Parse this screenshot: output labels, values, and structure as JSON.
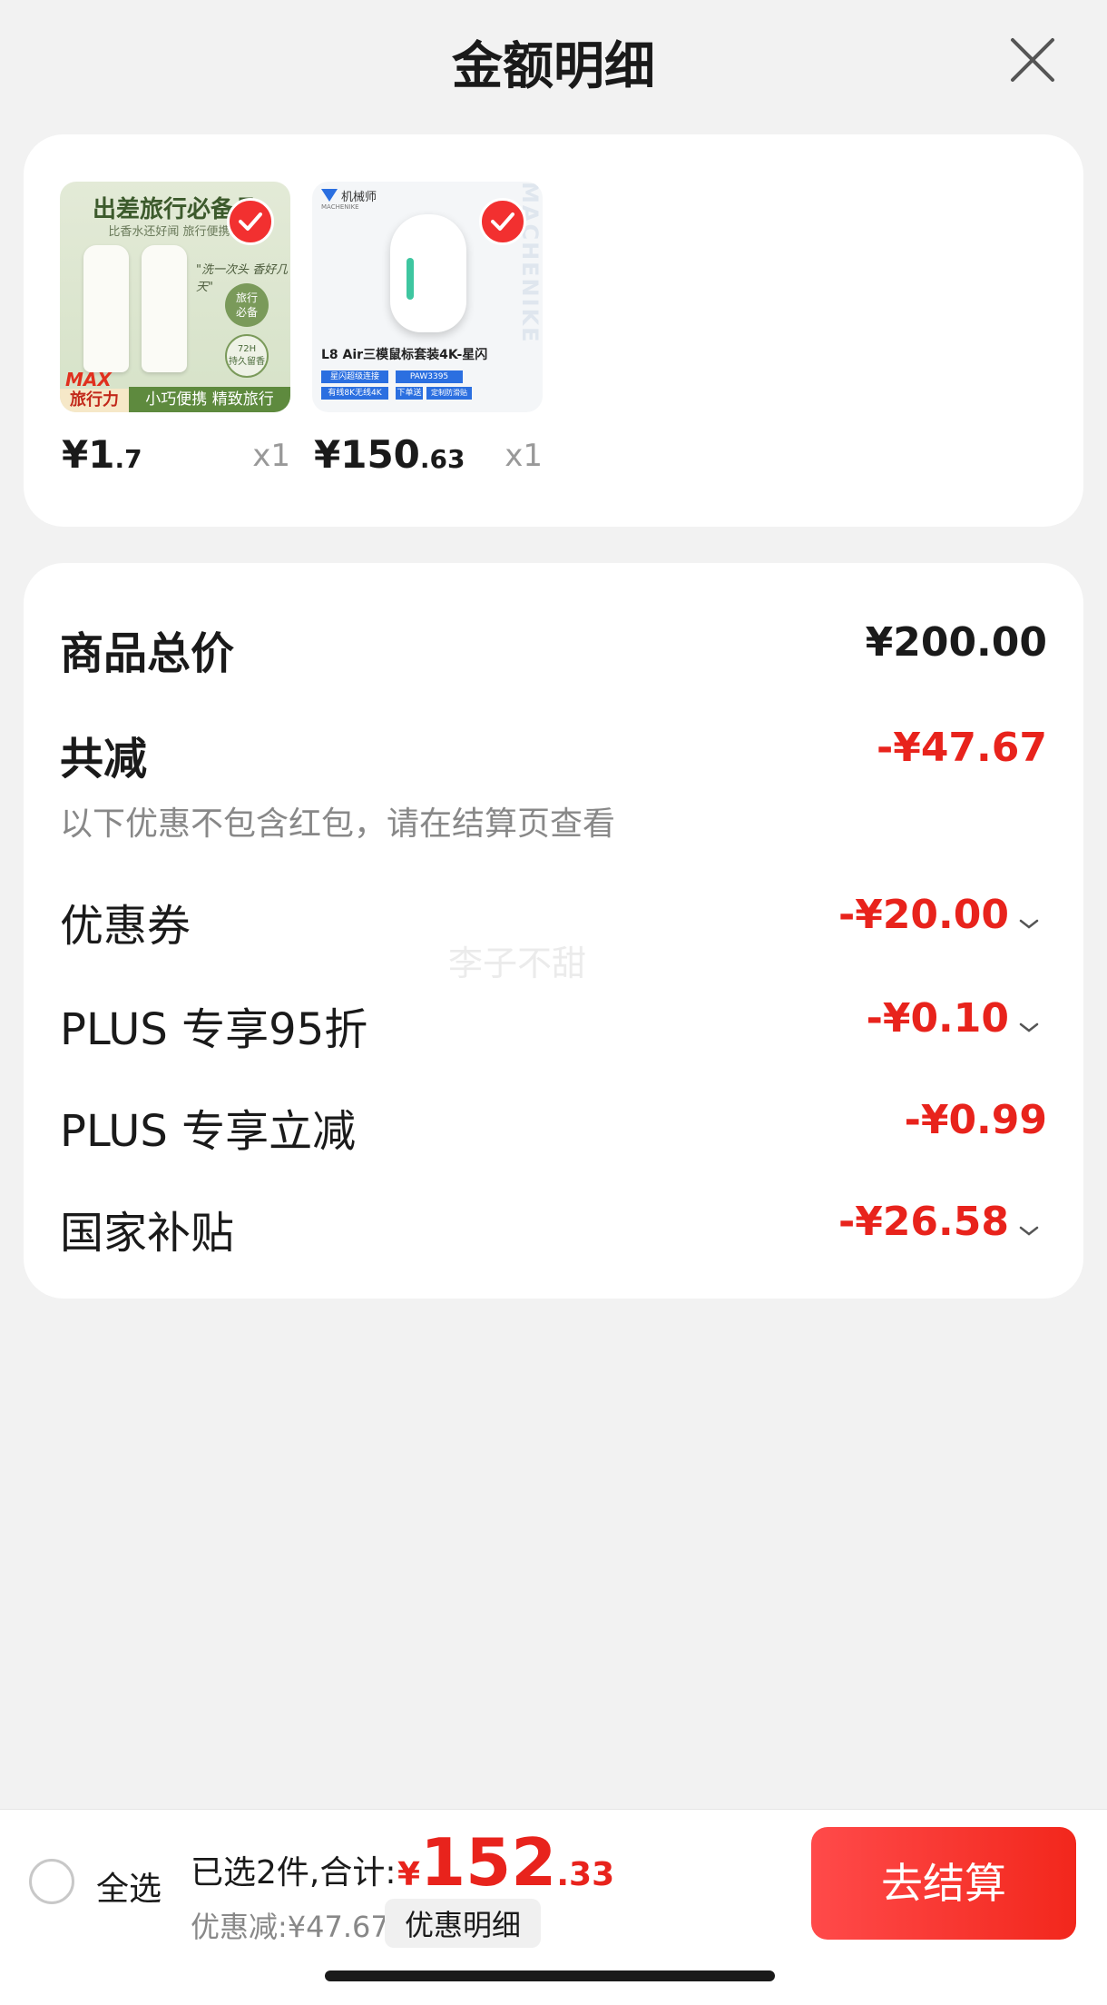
{
  "header": {
    "title": "金额明细"
  },
  "products": [
    {
      "price_int": "¥1",
      "price_dec": ".7",
      "qty": "x1",
      "image_text": {
        "headline": "出差旅行必备品",
        "sub": "比香水还好闻 旅行便携装",
        "quote": "\"洗一次头 香好几天\"",
        "badge1": "旅行\n必备",
        "badge2": "72H\n持久留香",
        "max": "MAX",
        "max_sub": "旅行力",
        "strip": "小巧便携 精致旅行"
      }
    },
    {
      "price_int": "¥150",
      "price_dec": ".63",
      "qty": "x1",
      "image_text": {
        "brand": "机械师",
        "brand_en": "MACHENIKE",
        "model": "L8 Air三模鼠标套装4K-星闪",
        "tag1": "星闪超级连接",
        "tag2": "PAW3395",
        "tag3": "有线8K无线4K",
        "tag4": "下单送",
        "tag5": "定制防滑贴",
        "vertical": "MACHENIKE"
      }
    }
  ],
  "summary": {
    "total_label": "商品总价",
    "total_value": "¥200.00",
    "reduce_label": "共减",
    "reduce_value": "-¥47.67",
    "note": "以下优惠不包含红包，请在结算页查看",
    "items": [
      {
        "label": "优惠券",
        "value": "-¥20.00"
      },
      {
        "label": "PLUS 专享95折",
        "value": "-¥0.10"
      },
      {
        "label": "PLUS 专享立减",
        "value": "-¥0.99"
      },
      {
        "label": "国家补贴",
        "value": "-¥26.58"
      }
    ]
  },
  "watermark": "李子不甜",
  "footer": {
    "select_all": "全选",
    "selected_text": "已选2件,合计:",
    "total_currency": "¥",
    "total_int": "152",
    "total_dec": ".33",
    "discount_text": "优惠减:¥47.67",
    "detail_button": "优惠明细",
    "checkout_button": "去结算"
  },
  "colors": {
    "accent_red": "#e8231c",
    "background": "#f2f2f2"
  }
}
